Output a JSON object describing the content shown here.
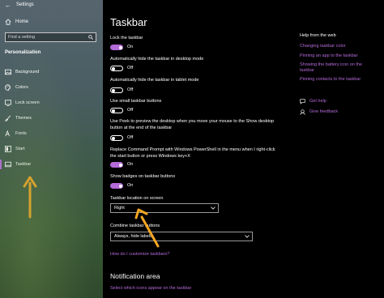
{
  "window": {
    "title": "Settings",
    "back_glyph": "←"
  },
  "sidebar": {
    "home_label": "Home",
    "search_placeholder": "Find a setting",
    "section_title": "Personalization",
    "items": [
      {
        "label": "Background",
        "icon": "picture-icon"
      },
      {
        "label": "Colors",
        "icon": "palette-icon"
      },
      {
        "label": "Lock screen",
        "icon": "lock-screen-icon"
      },
      {
        "label": "Themes",
        "icon": "brush-icon"
      },
      {
        "label": "Fonts",
        "icon": "font-icon"
      },
      {
        "label": "Start",
        "icon": "start-icon"
      },
      {
        "label": "Taskbar",
        "icon": "taskbar-icon",
        "active": true
      }
    ]
  },
  "main": {
    "title": "Taskbar",
    "options": [
      {
        "label": "Lock the taskbar",
        "state": "On"
      },
      {
        "label": "Automatically hide the taskbar in desktop mode",
        "state": "Off"
      },
      {
        "label": "Automatically hide the taskbar in tablet mode",
        "state": "Off"
      },
      {
        "label": "Use small taskbar buttons",
        "state": "Off"
      },
      {
        "label": "Use Peek to preview the desktop when you move your mouse to the Show desktop button at the end of the taskbar",
        "state": "Off"
      },
      {
        "label": "Replace Command Prompt with Windows PowerShell in the menu when I right-click the start button or press Windows key+X",
        "state": "On"
      },
      {
        "label": "Show badges on taskbar buttons",
        "state": "On"
      }
    ],
    "location_label": "Taskbar location on screen",
    "location_value": "Right",
    "combine_label": "Combine taskbar buttons",
    "combine_value": "Always, hide labels",
    "customize_link": "How do I customize taskbars?",
    "notification_heading": "Notification area",
    "notification_link": "Select which icons appear on the taskbar"
  },
  "help": {
    "title": "Help from the web",
    "links": [
      "Changing taskbar color",
      "Pinning an app to the taskbar",
      "Showing the battery icon on the taskbar",
      "Pinning contacts to the taskbar"
    ],
    "get_help": "Get help",
    "give_feedback": "Give feedback"
  },
  "colors": {
    "accent": "#b46ad8",
    "annotation_arrow": "#f5a623"
  }
}
